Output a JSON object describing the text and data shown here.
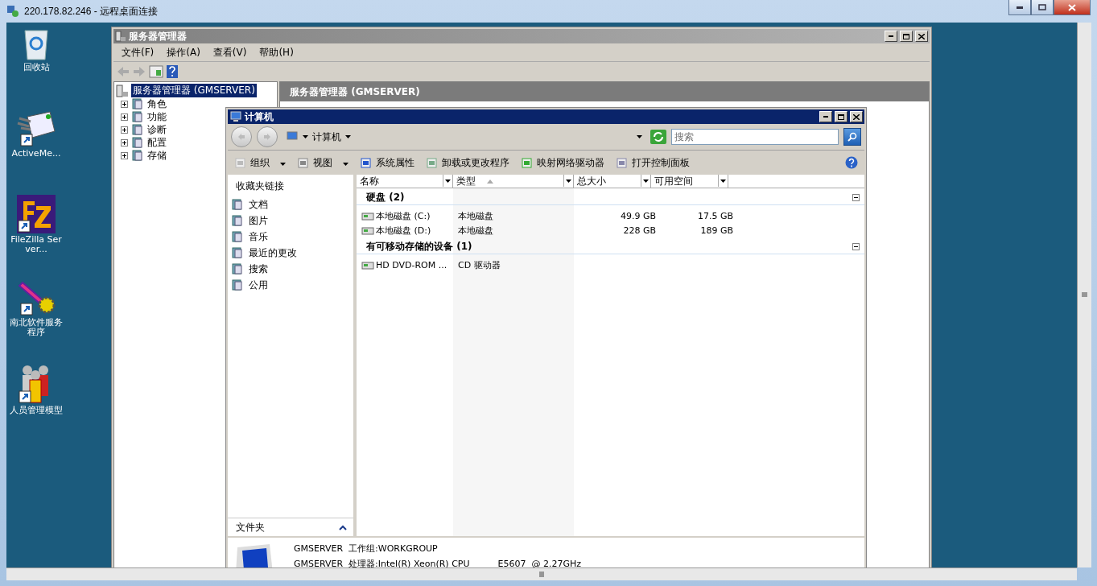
{
  "rdp_window": {
    "title": "220.178.82.246 - 远程桌面连接"
  },
  "desktop_icons": [
    {
      "kind": "recycle",
      "label": "回收站"
    },
    {
      "kind": "mail",
      "label": "ActiveMe..."
    },
    {
      "kind": "filezilla",
      "label": "FileZilla Server..."
    },
    {
      "kind": "gear",
      "label": "南北软件服务程序"
    },
    {
      "kind": "people",
      "label": "人员管理模型"
    }
  ],
  "server_manager": {
    "title": "服务器管理器",
    "menu": [
      "文件(F)",
      "操作(A)",
      "查看(V)",
      "帮助(H)"
    ],
    "tree": {
      "label": "服务器管理器 (GMSERVER)",
      "selected": true,
      "children": [
        {
          "label": "角色",
          "expanded": false
        },
        {
          "label": "功能",
          "expanded": false
        },
        {
          "label": "诊断",
          "expanded": false
        },
        {
          "label": "配置",
          "expanded": false
        },
        {
          "label": "存储",
          "expanded": false
        }
      ]
    },
    "header": "服务器管理器 (GMSERVER)"
  },
  "computer_window": {
    "title": "计算机",
    "breadcrumb": "计算机",
    "search": {
      "placeholder": "搜索"
    },
    "commands": [
      {
        "label": "组织",
        "dropdown": true
      },
      {
        "label": "视图",
        "dropdown": true
      },
      {
        "label": "系统属性",
        "dropdown": false
      },
      {
        "label": "卸载或更改程序",
        "dropdown": false
      },
      {
        "label": "映射网络驱动器",
        "dropdown": false
      },
      {
        "label": "打开控制面板",
        "dropdown": false
      }
    ],
    "favorites_title": "收藏夹链接",
    "favorites": [
      "文档",
      "图片",
      "音乐",
      "最近的更改",
      "搜索",
      "公用"
    ],
    "folders_label": "文件夹",
    "columns": [
      {
        "label": "名称",
        "sorted": false
      },
      {
        "label": "类型",
        "sorted": true
      },
      {
        "label": "总大小",
        "sorted": false
      },
      {
        "label": "可用空间",
        "sorted": false
      }
    ],
    "groups": [
      {
        "title": "硬盘 (2)",
        "expanded": true,
        "items": [
          {
            "name": "本地磁盘 (C:)",
            "type": "本地磁盘",
            "total": "49.9 GB",
            "free": "17.5 GB"
          },
          {
            "name": "本地磁盘 (D:)",
            "type": "本地磁盘",
            "total": "228 GB",
            "free": "189 GB"
          }
        ]
      },
      {
        "title": "有可移动存储的设备 (1)",
        "expanded": true,
        "items": [
          {
            "name": "HD DVD-ROM ...",
            "type": "CD 驱动器"
          }
        ]
      }
    ],
    "details": [
      {
        "name": "GMSERVER",
        "label": "工作组:",
        "value": "WORKGROUP"
      },
      {
        "name": "GMSERVER",
        "label": "处理器:",
        "value": "Intel(R) Xeon(R) CPU          E5607  @ 2.27GHz"
      }
    ]
  }
}
